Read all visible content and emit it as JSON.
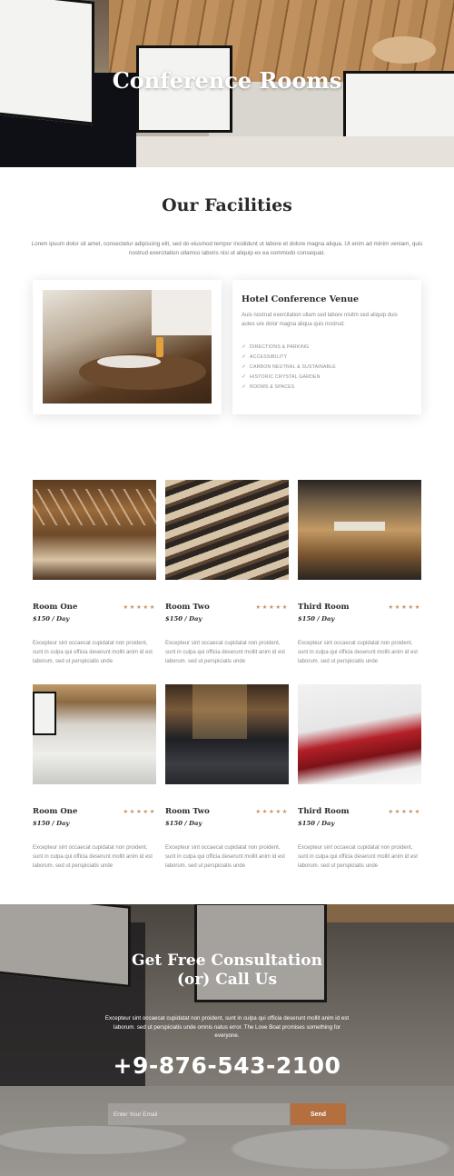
{
  "hero": {
    "title": "Conference Rooms"
  },
  "facilities": {
    "title": "Our Facilities",
    "intro": "Lorem ipsum dolor sit amet, consectetur adipiscing elit, sed do eiusmod tempor incididunt ut labore et dolore magna aliqua. Ut enim ad minim veniam, quis nostrud exercitation ullamco laboris nisi ut aliquip ex ea commodo consequat."
  },
  "venue": {
    "title": "Hotel Conference Venue",
    "description": "Auis nostrud exercitation ullam sed labore nisitm sed aliquip duis autes ure dolor magna aliqua quis nostrud.",
    "features": [
      "DIRECTIONS & PARKING",
      "ACCESSIBILITY",
      "CARBON NEUTRAL & SUSTAINABLE",
      "HISTORIC CRYSTAL GARDEN",
      "ROOMS & SPACES"
    ],
    "check_icon": "check-icon"
  },
  "rooms": [
    {
      "name": "Room One",
      "price": "$150 / Day",
      "stars": "★★★★★",
      "description": "Excepteur sint occaecat cupidatat non proident, sunt in culpa qui officia deserunt mollit anim id est laborum. sed ut perspiciatis unde",
      "image": "parliament-chamber-photo"
    },
    {
      "name": "Room Two",
      "price": "$150 / Day",
      "stars": "★★★★★",
      "description": "Excepteur sint occaecat cupidatat non proident, sunt in culpa qui officia deserunt mollit anim id est laborum. sed ut perspiciatis unde",
      "image": "curved-seating-photo"
    },
    {
      "name": "Third Room",
      "price": "$150 / Day",
      "stars": "★★★★★",
      "description": "Excepteur sint occaecat cupidatat non proident, sunt in culpa qui officia deserunt mollit anim id est laborum. sed ut perspiciatis unde",
      "image": "concert-hall-photo"
    },
    {
      "name": "Room One",
      "price": "$150 / Day",
      "stars": "★★★★★",
      "description": "Excepteur sint occaecat cupidatat non proident, sunt in culpa qui officia deserunt mollit anim id est laborum. sed ut perspiciatis unde",
      "image": "conference-room-photo"
    },
    {
      "name": "Room Two",
      "price": "$150 / Day",
      "stars": "★★★★★",
      "description": "Excepteur sint occaecat cupidatat non proident, sunt in culpa qui officia deserunt mollit anim id est laborum. sed ut perspiciatis unde",
      "image": "restaurant-room-photo"
    },
    {
      "name": "Third Room",
      "price": "$150 / Day",
      "stars": "★★★★★",
      "description": "Excepteur sint occaecat cupidatat non proident, sunt in culpa qui officia deserunt mollit anim id est laborum. sed ut perspiciatis unde",
      "image": "meeting-table-photo"
    }
  ],
  "cta": {
    "title_line1": "Get Free Consultation",
    "title_line2": "(or) Call Us",
    "text": "Excepteur sint occaecat cupidatat non proident, sunt in culpa qui officia deserunt mollit anim id est laborum. sed ut perspiciatis unde omnis natus error. The Love Boat promises something for everyone.",
    "phone": "+9-876-543-2100",
    "email_placeholder": "Enter Your Email",
    "send_label": "Send"
  },
  "colors": {
    "accent": "#b46f41",
    "star": "#c8956a",
    "heading": "#2a2a2a"
  }
}
